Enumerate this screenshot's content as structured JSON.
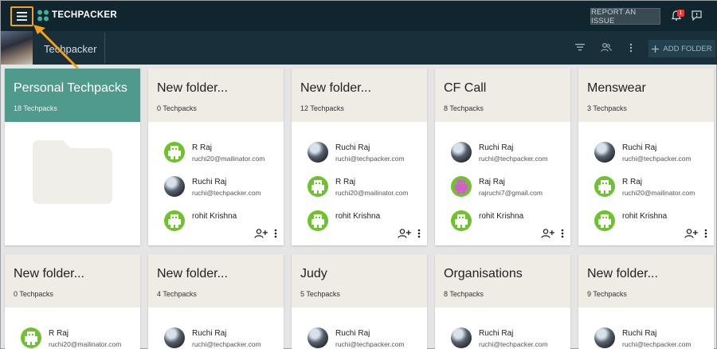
{
  "header": {
    "brand": "TECHPACKER",
    "report_label": "REPORT AN ISSUE",
    "notification_count": "1"
  },
  "workspace": {
    "name": "Techpacker",
    "add_folder_label": "ADD FOLDER"
  },
  "colors": {
    "topbar": "#11252f",
    "subbar": "#19303b",
    "personal_accent": "#4f9a8d",
    "card_head": "#efece6",
    "highlight": "#f5a01a"
  },
  "folders": [
    {
      "title": "Personal Techpacks",
      "count": "18 Techpacks",
      "members": []
    },
    {
      "title": "New folder...",
      "count": "0 Techpacks",
      "members": [
        {
          "name": "R Raj",
          "email": "ruchi20@mailinator.com",
          "avatar": "green"
        },
        {
          "name": "Ruchi Raj",
          "email": "ruchi@techpacker.com",
          "avatar": "photo"
        },
        {
          "name": "rohit Krishna",
          "email": "",
          "avatar": "green"
        }
      ]
    },
    {
      "title": "New folder...",
      "count": "12 Techpacks",
      "members": [
        {
          "name": "Ruchi Raj",
          "email": "ruchi@techpacker.com",
          "avatar": "photo"
        },
        {
          "name": "R Raj",
          "email": "ruchi20@mailinator.com",
          "avatar": "green"
        },
        {
          "name": "rohit Krishna",
          "email": "",
          "avatar": "green"
        }
      ]
    },
    {
      "title": "CF Call",
      "count": "8 Techpacks",
      "members": [
        {
          "name": "Ruchi Raj",
          "email": "ruchi@techpacker.com",
          "avatar": "photo"
        },
        {
          "name": "Raj Raj",
          "email": "rajruchi7@gmail.com",
          "avatar": "pink"
        },
        {
          "name": "rohit Krishna",
          "email": "",
          "avatar": "green"
        }
      ]
    },
    {
      "title": "Menswear",
      "count": "3 Techpacks",
      "members": [
        {
          "name": "Ruchi Raj",
          "email": "ruchi@techpacker.com",
          "avatar": "photo"
        },
        {
          "name": "R Raj",
          "email": "ruchi20@mailinator.com",
          "avatar": "green"
        },
        {
          "name": "rohit Krishna",
          "email": "",
          "avatar": "green"
        }
      ]
    },
    {
      "title": "New folder...",
      "count": "0 Techpacks",
      "members": [
        {
          "name": "R Raj",
          "email": "ruchi20@mailinator.com",
          "avatar": "green"
        }
      ]
    },
    {
      "title": "New folder...",
      "count": "4 Techpacks",
      "members": [
        {
          "name": "Ruchi Raj",
          "email": "ruchi@techpacker.com",
          "avatar": "photo"
        }
      ]
    },
    {
      "title": "Judy",
      "count": "5 Techpacks",
      "members": [
        {
          "name": "Ruchi Raj",
          "email": "ruchi@techpacker.com",
          "avatar": "photo"
        }
      ]
    },
    {
      "title": "Organisations",
      "count": "8 Techpacks",
      "members": [
        {
          "name": "Ruchi Raj",
          "email": "ruchi@techpacker.com",
          "avatar": "photo"
        }
      ]
    },
    {
      "title": "New folder...",
      "count": "9 Techpacks",
      "members": [
        {
          "name": "Ruchi Raj",
          "email": "ruchi@techpacker.com",
          "avatar": "photo"
        }
      ]
    }
  ]
}
